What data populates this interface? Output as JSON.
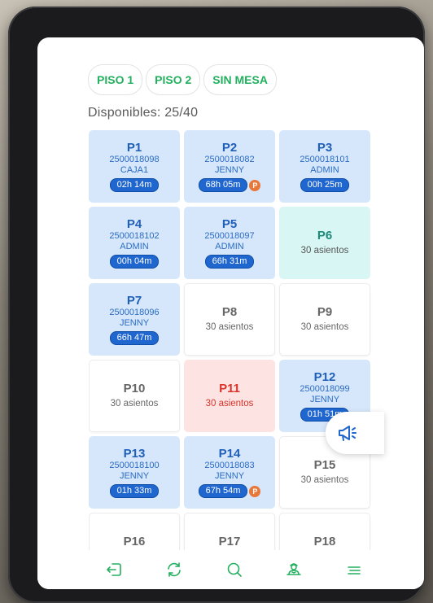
{
  "tabs": [
    {
      "label": "PISO 1"
    },
    {
      "label": "PISO 2"
    },
    {
      "label": "SIN MESA"
    }
  ],
  "availability": "Disponibles: 25/40",
  "tables": [
    {
      "name": "P1",
      "status": "occupied",
      "order": "2500018098",
      "user": "CAJA1",
      "time": "02h 14m",
      "p": ""
    },
    {
      "name": "P2",
      "status": "occupied",
      "order": "2500018082",
      "user": "JENNY",
      "time": "68h 05m",
      "p": "P"
    },
    {
      "name": "P3",
      "status": "occupied",
      "order": "2500018101",
      "user": "ADMIN",
      "time": "00h 25m",
      "p": ""
    },
    {
      "name": "P4",
      "status": "occupied",
      "order": "2500018102",
      "user": "ADMIN",
      "time": "00h 04m",
      "p": ""
    },
    {
      "name": "P5",
      "status": "occupied",
      "order": "2500018097",
      "user": "ADMIN",
      "time": "66h 31m",
      "p": ""
    },
    {
      "name": "P6",
      "status": "teal",
      "seats": "30 asientos"
    },
    {
      "name": "P7",
      "status": "occupied",
      "order": "2500018096",
      "user": "JENNY",
      "time": "66h 47m",
      "p": ""
    },
    {
      "name": "P8",
      "status": "free",
      "seats": "30 asientos"
    },
    {
      "name": "P9",
      "status": "free",
      "seats": "30 asientos"
    },
    {
      "name": "P10",
      "status": "free",
      "seats": "30 asientos"
    },
    {
      "name": "P11",
      "status": "red",
      "seats": "30 asientos"
    },
    {
      "name": "P12",
      "status": "occupied",
      "order": "2500018099",
      "user": "JENNY",
      "time": "01h 51m",
      "p": ""
    },
    {
      "name": "P13",
      "status": "occupied",
      "order": "2500018100",
      "user": "JENNY",
      "time": "01h 33m",
      "p": ""
    },
    {
      "name": "P14",
      "status": "occupied",
      "order": "2500018083",
      "user": "JENNY",
      "time": "67h 54m",
      "p": "P"
    },
    {
      "name": "P15",
      "status": "free",
      "seats": "30 asientos"
    },
    {
      "name": "P16",
      "status": "free",
      "seats": ""
    },
    {
      "name": "P17",
      "status": "free",
      "seats": ""
    },
    {
      "name": "P18",
      "status": "free",
      "seats": ""
    }
  ],
  "bottom_nav": [
    {
      "icon": "logout-icon"
    },
    {
      "icon": "refresh-icon"
    },
    {
      "icon": "search-icon"
    },
    {
      "icon": "waiter-icon"
    },
    {
      "icon": "menu-icon"
    }
  ],
  "fab": {
    "icon": "megaphone-icon"
  },
  "colors": {
    "accent": "#22b05e",
    "occupied": "#d7e7fb",
    "time_badge": "#1f66cf",
    "alert": "#d9332b",
    "free_teal": "#d8f6f4"
  }
}
